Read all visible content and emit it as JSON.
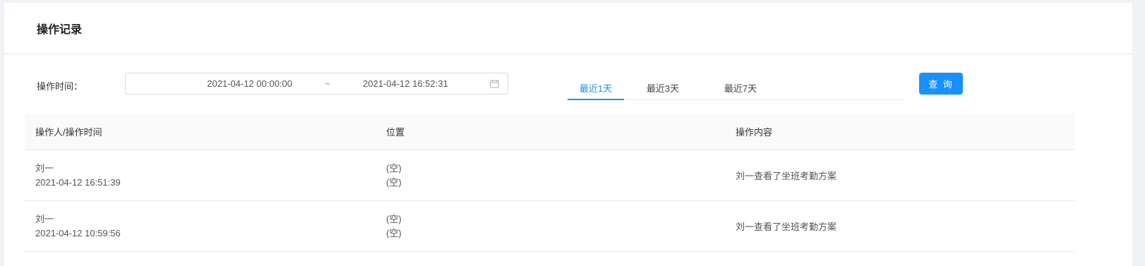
{
  "header": {
    "title": "操作记录"
  },
  "filter": {
    "label": "操作时间：",
    "start": "2021-04-12 00:00:00",
    "separator": "~",
    "end": "2021-04-12 16:52:31",
    "icon": "calendar-icon"
  },
  "tabs": [
    {
      "label": "最近1天",
      "active": true
    },
    {
      "label": "最近3天",
      "active": false
    },
    {
      "label": "最近7天",
      "active": false
    }
  ],
  "query_label": "查 询",
  "accent_color": "#1890ff",
  "table": {
    "columns": [
      "操作人/操作时间",
      "位置",
      "操作内容"
    ],
    "rows": [
      {
        "operator": "刘一",
        "time": "2021-04-12 16:51:39",
        "loc1": "(空)",
        "loc2": "(空)",
        "content": "刘一查看了坐班考勤方案"
      },
      {
        "operator": "刘一",
        "time": "2021-04-12 10:59:56",
        "loc1": "(空)",
        "loc2": "(空)",
        "content": "刘一查看了坐班考勤方案"
      }
    ]
  }
}
